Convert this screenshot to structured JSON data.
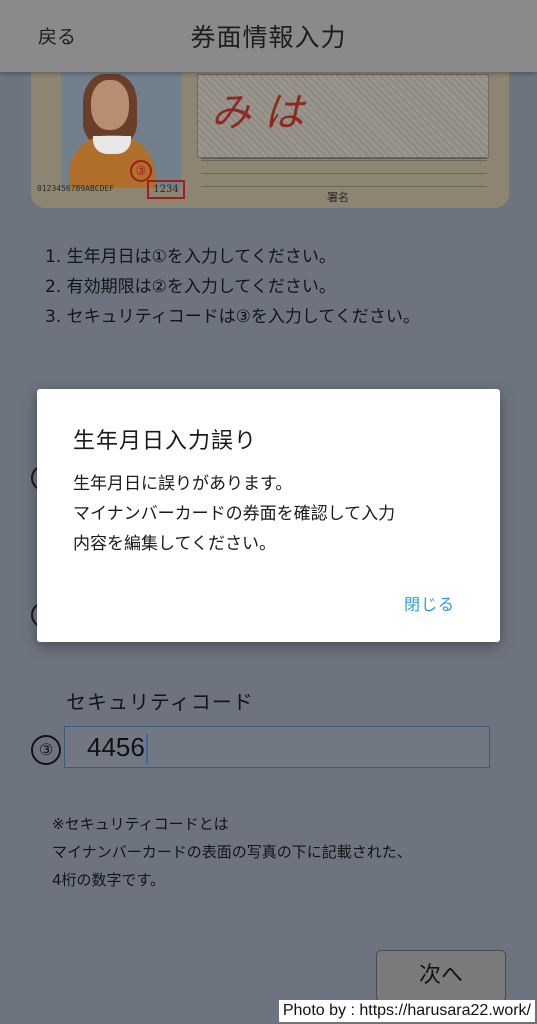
{
  "header": {
    "back_label": "戻る",
    "title": "券面情報入力"
  },
  "card": {
    "marker": "③",
    "serial": "0123456789ABCDEF",
    "security_code": "1234",
    "sign_label": "署名",
    "red_text": "み は"
  },
  "instructions": [
    "1. 生年月日は①を入力してください。",
    "2. 有効期限は②を入力してください。",
    "3. セキュリティコードは③を入力してください。"
  ],
  "form": {
    "row1_marker": "①",
    "row2_marker": "②",
    "security_label": "セキュリティコード",
    "security_marker": "③",
    "security_value": "4456"
  },
  "note": {
    "line1": "※セキュリティコードとは",
    "line2": "マイナンバーカードの表面の写真の下に記載された、",
    "line3": "4桁の数字です。"
  },
  "next_button": "次へ",
  "credit": "Photo by : https://harusara22.work/",
  "modal": {
    "title": "生年月日入力誤り",
    "line1": "生年月日に誤りがあります。",
    "line2": "マイナンバーカードの券面を確認して入力",
    "line3": "内容を編集してください。",
    "close_label": "閉じる",
    "close_color": "#2d9cd6"
  }
}
